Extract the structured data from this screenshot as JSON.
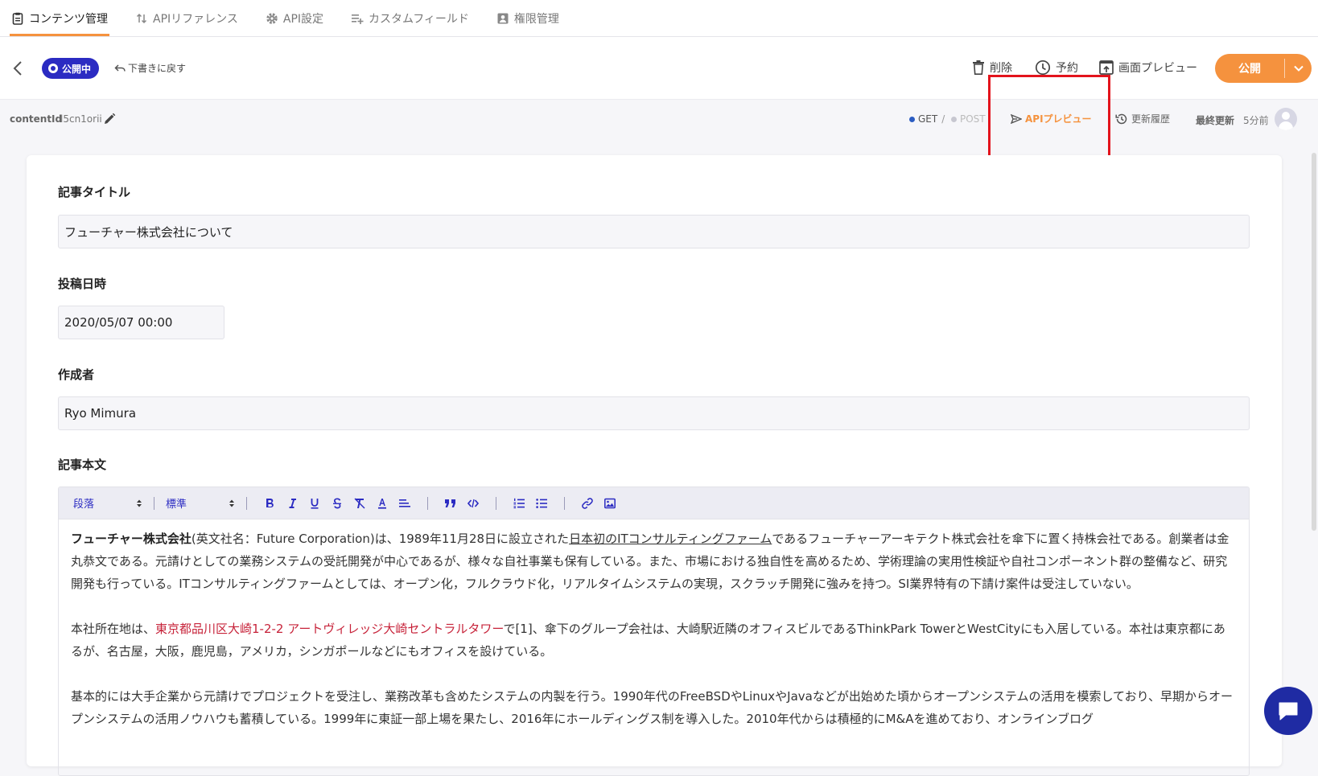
{
  "nav": {
    "tabs": [
      {
        "label": "コンテンツ管理",
        "icon": "clipboard-icon",
        "active": true
      },
      {
        "label": "APIリファレンス",
        "icon": "sort-arrows-icon"
      },
      {
        "label": "API設定",
        "icon": "gear-icon"
      },
      {
        "label": "カスタムフィールド",
        "icon": "playlist-add-icon"
      },
      {
        "label": "権限管理",
        "icon": "account-box-icon"
      }
    ]
  },
  "header": {
    "status": "公開中",
    "revert": "下書きに戻す",
    "delete": "削除",
    "schedule": "予約",
    "screen_preview": "画面プレビュー",
    "publish": "公開"
  },
  "meta": {
    "content_id_label": "contentId",
    "content_id": "l5cn1orii",
    "get": "GET",
    "slash": "/",
    "post": "POST",
    "api_preview": "APIプレビュー",
    "history": "更新履歴",
    "last_updated_label": "最終更新",
    "last_updated": "5分前"
  },
  "form": {
    "title_label": "記事タイトル",
    "title_value": "フューチャー株式会社について",
    "date_label": "投稿日時",
    "date_value": "2020/05/07 00:00",
    "author_label": "作成者",
    "author_value": "Ryo Mimura",
    "body_label": "記事本文"
  },
  "editor": {
    "block_select": "段落",
    "style_select": "標準",
    "p1": {
      "bold": "フューチャー株式会社",
      "t1": "(英文社名：Future Corporation)は、1989年11月28日に設立された",
      "link": "日本初のITコンサルティングファーム",
      "t2": "であるフューチャーアーキテクト株式会社を傘下に置く持株会社である。創業者は金丸恭文である。元請けとしての業務システムの受託開発が中心であるが、様々な自社事業も保有している。また、市場における独自性を高めるため、学術理論の実用性検証や自社コンポーネント群の整備など、研究開発も行っている。ITコンサルティングファームとしては、オープン化，フルクラウド化，リアルタイムシステムの実現，スクラッチ開発に強みを持つ。SI業界特有の下請け案件は受注していない。"
    },
    "p2": {
      "t1": "本社所在地は、",
      "red": "東京都品川区大崎1-2-2 アートヴィレッジ大崎セントラルタワー",
      "t2": "で[1]、傘下のグループ会社は、大崎駅近隣のオフィスビルであるThinkPark TowerとWestCityにも入居している。本社は東京都にあるが、名古屋，大阪，鹿児島，アメリカ，シンガポールなどにもオフィスを設けている。"
    },
    "p3": "基本的には大手企業から元請けでプロジェクトを受注し、業務改革も含めたシステムの内製を行う。1990年代のFreeBSDやLinuxやJavaなどが出始めた頃からオープンシステムの活用を模索しており、早期からオープンシステムの活用ノウハウも蓄積している。1999年に東証一部上場を果たし、2016年にホールディングス制を導入した。2010年代からは積極的にM&Aを進めており、オンラインブログ"
  },
  "colors": {
    "accent": "#f5923e",
    "brand": "#2b2bc2",
    "highlight": "#e3131c"
  }
}
